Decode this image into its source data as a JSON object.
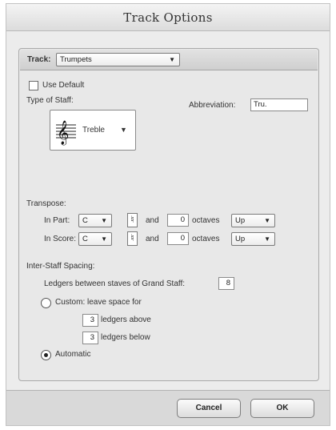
{
  "window": {
    "title": "Track Options"
  },
  "track": {
    "label": "Track:",
    "value": "Trumpets"
  },
  "use_default": {
    "label": "Use Default",
    "checked": false
  },
  "type_of_staff": {
    "label": "Type of Staff:",
    "value": "Treble",
    "icon": "treble-clef-staff-icon"
  },
  "abbreviation": {
    "label": "Abbreviation:",
    "value": "Tru."
  },
  "transpose": {
    "label": "Transpose:",
    "rows": [
      {
        "label": "In Part:",
        "key": "C",
        "accidental": "♮",
        "and": "and",
        "octaves": "0",
        "octaves_label": "octaves",
        "direction": "Up"
      },
      {
        "label": "In Score:",
        "key": "C",
        "accidental": "♮",
        "and": "and",
        "octaves": "0",
        "octaves_label": "octaves",
        "direction": "Up"
      }
    ]
  },
  "spacing": {
    "label": "Inter-Staff Spacing:",
    "ledgers_grand_label": "Ledgers between staves of Grand Staff:",
    "ledgers_grand_value": "8",
    "custom_label": "Custom: leave space for",
    "custom_selected": false,
    "above_value": "3",
    "above_label": "ledgers above",
    "below_value": "3",
    "below_label": "ledgers below",
    "automatic_label": "Automatic",
    "automatic_selected": true
  },
  "buttons": {
    "cancel": "Cancel",
    "ok": "OK"
  }
}
